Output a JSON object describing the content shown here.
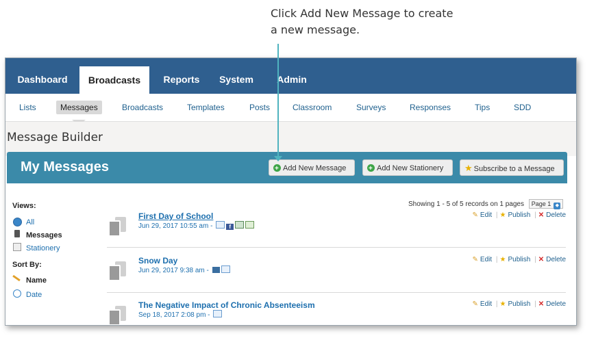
{
  "callout": {
    "line1": "Click Add New Message to create",
    "line2": "a new message."
  },
  "topnav": {
    "tabs": [
      "Dashboard",
      "Broadcasts",
      "Reports",
      "System",
      "Admin"
    ],
    "active": "Broadcasts"
  },
  "subnav": {
    "items": [
      "Lists",
      "Messages",
      "Broadcasts",
      "Templates",
      "Posts",
      "Classroom",
      "Surveys",
      "Responses",
      "Tips",
      "SDD"
    ],
    "active": "Messages"
  },
  "page_title": "Message Builder",
  "panel": {
    "title": "My Messages",
    "buttons": {
      "add_message": "Add New Message",
      "add_stationery": "Add New Stationery",
      "subscribe": "Subscribe to a Message"
    }
  },
  "sidebar": {
    "views_label": "Views:",
    "views": [
      "All",
      "Messages",
      "Stationery"
    ],
    "sort_label": "Sort By:",
    "sort": [
      "Name",
      "Date"
    ]
  },
  "listing": {
    "showing": "Showing 1 - 5 of 5 records on 1 pages",
    "page_select": "Page 1",
    "messages": [
      {
        "title": "First Day of School",
        "date": "Jun 29, 2017 10:55 am -"
      },
      {
        "title": "Snow Day",
        "date": "Jun 29, 2017 9:38 am -"
      },
      {
        "title": "The Negative Impact of Chronic Absenteeism",
        "date": "Sep 18, 2017 2:08 pm -"
      }
    ],
    "actions": {
      "edit": "Edit",
      "publish": "Publish",
      "delete": "Delete"
    }
  },
  "colors": {
    "header": "#2f5f8f",
    "panel": "#3b8aa9",
    "link": "#1d6fae",
    "arrow": "#4fb3bf"
  }
}
